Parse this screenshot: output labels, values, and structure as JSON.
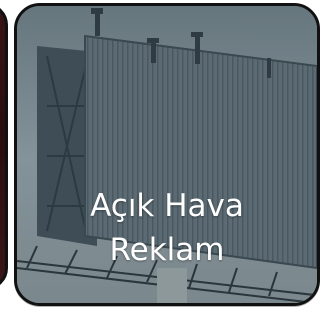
{
  "card": {
    "title_line1": "Açık Hava",
    "title_line2": "Reklam",
    "image_subject": "billboard-photo"
  },
  "colors": {
    "card_border": "#111111",
    "caption_text": "#ffffff",
    "side_card_fill": "#2a0d10"
  }
}
